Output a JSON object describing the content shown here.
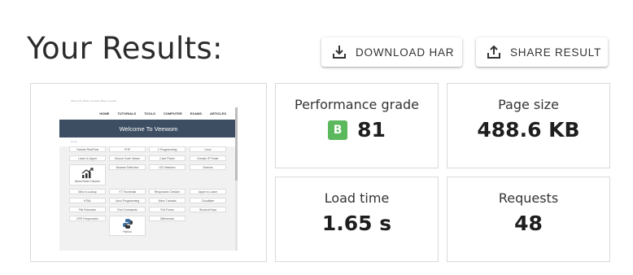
{
  "header": {
    "title": "Your Results:",
    "download_label": "DOWNLOAD HAR",
    "share_label": "SHARE RESULT"
  },
  "metrics": {
    "performance": {
      "label": "Performance grade",
      "grade": "B",
      "value": "81",
      "grade_color": "#5cb85c"
    },
    "page_size": {
      "label": "Page size",
      "value": "488.6 KB"
    },
    "load_time": {
      "label": "Load time",
      "value": "1.65 s"
    },
    "requests": {
      "label": "Requests",
      "value": "48"
    }
  },
  "thumbnail": {
    "banner": "Welcome To Veewom",
    "nav": [
      "HOME",
      "TUTORIALS",
      "TOOLS",
      "COMPUTER",
      "EXAMS",
      "ARTICLES"
    ],
    "top_links": "About Us   Write   Contact   Blog   Contact",
    "crumb": "Home",
    "banner_color": "#3d4e63",
    "tiles": [
      "Youtube RealTime",
      "PHP",
      "C Programming",
      "Linux",
      "Lower to Upper",
      "Source Code Viewer",
      "Color Picker",
      "Domain IP Finder",
      "Browser Detection",
      "OS Detection",
      "Devices",
      "Who is Lookup",
      "YT Thumbnail",
      "Responsive Checker",
      "Upper to Lower",
      "HTML",
      "Linux Programming",
      "Video Tutorials",
      "Cloudflare",
      "File Extension",
      "Run Commands",
      "Full Forms",
      "Shortcut Keys",
      "DPS Frequencies",
      "Differences"
    ],
    "alexa_label": "Alexa Rank Checker",
    "python_label": "Python"
  },
  "icons": {
    "download": "download-icon",
    "share": "share-upload-icon"
  }
}
